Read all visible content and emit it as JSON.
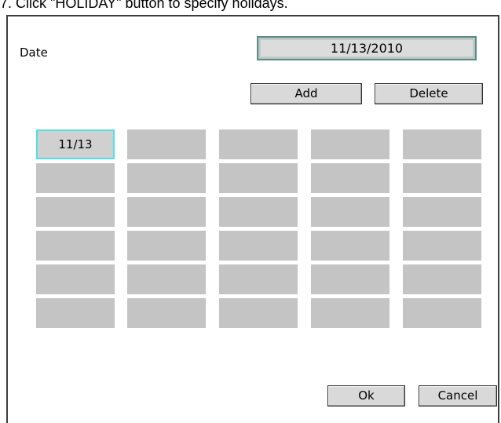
{
  "caption": "7.  Click \"HOLIDAY\" button to specify holidays.",
  "date": {
    "label": "Date",
    "value": "11/13/2010"
  },
  "buttons": {
    "add": "Add",
    "delete": "Delete",
    "ok": "Ok",
    "cancel": "Cancel"
  },
  "holiday_grid": {
    "columns": 5,
    "rows": 6,
    "selected_index": 0,
    "cells": [
      "11/13",
      "",
      "",
      "",
      "",
      "",
      "",
      "",
      "",
      "",
      "",
      "",
      "",
      "",
      "",
      "",
      "",
      "",
      "",
      "",
      "",
      "",
      "",
      "",
      "",
      "",
      "",
      "",
      "",
      ""
    ]
  }
}
